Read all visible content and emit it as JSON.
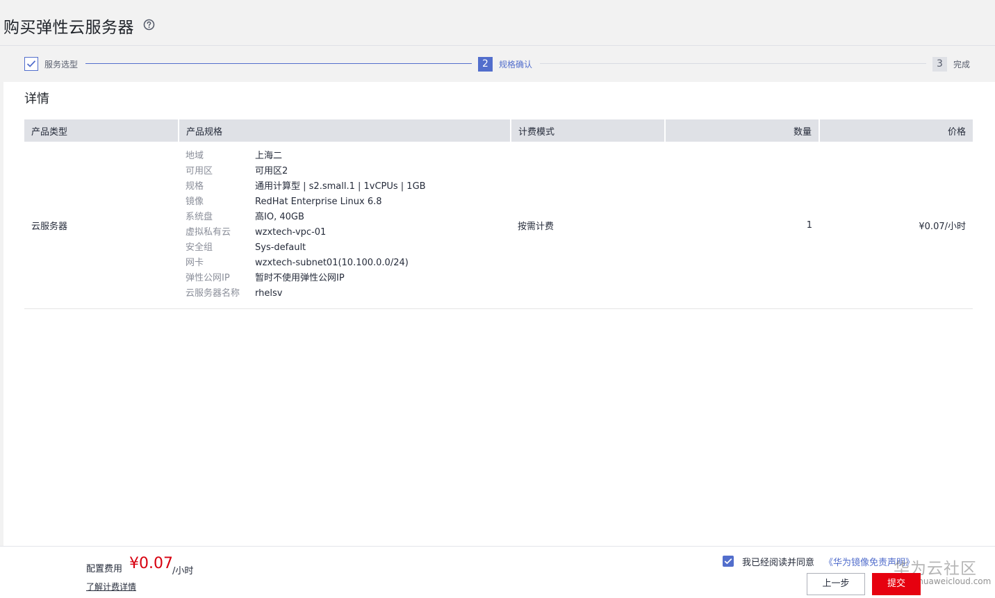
{
  "header": {
    "title": "购买弹性云服务器",
    "help_icon": "question-circle-icon"
  },
  "steps": [
    {
      "label": "服务选型",
      "state": "done"
    },
    {
      "number": "2",
      "label": "规格确认",
      "state": "active"
    },
    {
      "number": "3",
      "label": "完成",
      "state": "pending"
    }
  ],
  "detail": {
    "title": "详情",
    "columns": [
      "产品类型",
      "产品规格",
      "计费模式",
      "数量",
      "价格"
    ],
    "row": {
      "product_type": "云服务器",
      "specs": [
        {
          "key": "地域",
          "value": "上海二"
        },
        {
          "key": "可用区",
          "value": "可用区2"
        },
        {
          "key": "规格",
          "value": "通用计算型 | s2.small.1 | 1vCPUs | 1GB"
        },
        {
          "key": "镜像",
          "value": "RedHat Enterprise Linux 6.8"
        },
        {
          "key": "系统盘",
          "value": "高IO, 40GB"
        },
        {
          "key": "虚拟私有云",
          "value": "wzxtech-vpc-01"
        },
        {
          "key": "安全组",
          "value": "Sys-default"
        },
        {
          "key": "网卡",
          "value": "wzxtech-subnet01(10.100.0.0/24)"
        },
        {
          "key": "弹性公网IP",
          "value": "暂时不使用弹性公网IP"
        },
        {
          "key": "云服务器名称",
          "value": "rhelsv"
        }
      ],
      "billing_mode": "按需计费",
      "quantity": "1",
      "price": "¥0.07/小时"
    }
  },
  "footer": {
    "fee_label": "配置费用",
    "fee_amount": "¥0.07",
    "fee_unit": "/小时",
    "fee_link": "了解计费详情",
    "agree_text": "我已经阅读并同意",
    "agree_link": "《华为镜像免责声明》",
    "agree_checked": true,
    "prev_button": "上一步",
    "submit_button": "提交",
    "watermark_title": "华为云社区",
    "watermark_url": "bbs.huaweicloud.com"
  },
  "colors": {
    "accent": "#526ecc",
    "price_red": "#d7000f",
    "submit_red": "#e6010f"
  }
}
